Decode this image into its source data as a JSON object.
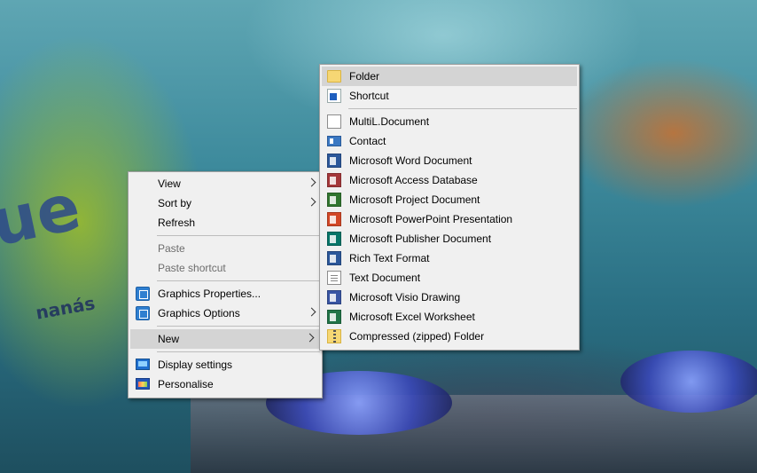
{
  "wallpaper": {
    "can_text": "ue",
    "can_sub": "nanás"
  },
  "context_menu": {
    "items": [
      {
        "label": "View",
        "has_submenu": true
      },
      {
        "label": "Sort by",
        "has_submenu": true
      },
      {
        "label": "Refresh"
      },
      {
        "label": "Paste",
        "disabled": true
      },
      {
        "label": "Paste shortcut",
        "disabled": true
      },
      {
        "label": "Graphics Properties...",
        "icon": "graphics-icon"
      },
      {
        "label": "Graphics Options",
        "icon": "graphics-icon",
        "has_submenu": true
      },
      {
        "label": "New",
        "has_submenu": true,
        "highlighted": true
      },
      {
        "label": "Display settings",
        "icon": "display-icon"
      },
      {
        "label": "Personalise",
        "icon": "personalise-icon"
      }
    ]
  },
  "new_submenu": {
    "items": [
      {
        "label": "Folder",
        "icon": "folder-icon",
        "highlighted": true
      },
      {
        "label": "Shortcut",
        "icon": "shortcut-icon"
      },
      {
        "label": "MultiL.Document",
        "icon": "document-icon"
      },
      {
        "label": "Contact",
        "icon": "contact-icon"
      },
      {
        "label": "Microsoft Word Document",
        "icon": "word-icon"
      },
      {
        "label": "Microsoft Access Database",
        "icon": "access-icon"
      },
      {
        "label": "Microsoft Project Document",
        "icon": "project-icon"
      },
      {
        "label": "Microsoft PowerPoint Presentation",
        "icon": "powerpoint-icon"
      },
      {
        "label": "Microsoft Publisher Document",
        "icon": "publisher-icon"
      },
      {
        "label": "Rich Text Format",
        "icon": "rich-text-icon"
      },
      {
        "label": "Text Document",
        "icon": "text-document-icon"
      },
      {
        "label": "Microsoft Visio Drawing",
        "icon": "visio-icon"
      },
      {
        "label": "Microsoft Excel Worksheet",
        "icon": "excel-icon"
      },
      {
        "label": "Compressed (zipped) Folder",
        "icon": "zip-folder-icon"
      }
    ]
  },
  "colors": {
    "menu_background": "#f0f0f0",
    "menu_highlight": "#d4d4d4",
    "disabled_text": "#6d6d6d"
  }
}
